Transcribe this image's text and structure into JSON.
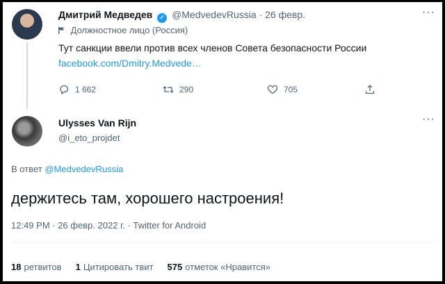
{
  "tweet1": {
    "name": "Дмитрий Медведев",
    "handle": "@MedvedevRussia",
    "separator": "·",
    "date": "26 февр.",
    "label": "Должностное лицо (Россия)",
    "text": "Тут санкции ввели против всех членов Совета безопасности России",
    "link": "facebook.com/Dmitry.Medvede…",
    "replies": "1 662",
    "retweets": "290",
    "likes": "705",
    "more": "···"
  },
  "tweet2": {
    "name": "Ulysses Van Rijn",
    "handle": "@i_eto_projdet",
    "more": "···",
    "reply_prefix": "В ответ",
    "reply_handle": "@MedvedevRussia",
    "text": "держитесь там, хорошего настроения!",
    "meta": "12:49 PM · 26 февр. 2022 г. · Twitter for Android",
    "stats": {
      "retweets_count": "18",
      "retweets_label": "ретвитов",
      "quotes_count": "1",
      "quotes_label": "Цитировать твит",
      "likes_count": "575",
      "likes_label": "отметок «Нравится»"
    }
  },
  "colors": {
    "accent": "#1d9bf0",
    "muted": "#536471",
    "text": "#0f1419"
  },
  "icons": [
    "reply-icon",
    "retweet-icon",
    "like-icon",
    "share-icon",
    "verified-badge-icon",
    "flag-icon",
    "more-icon"
  ]
}
